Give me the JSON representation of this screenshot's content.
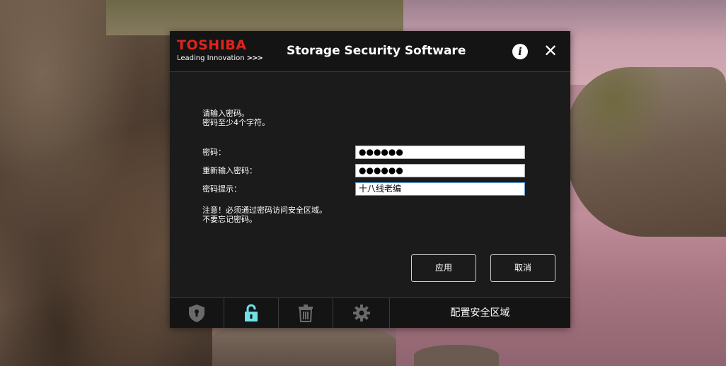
{
  "window": {
    "brand": "TOSHIBA",
    "tagline": "Leading Innovation",
    "tagline_arrows": ">>>",
    "title": "Storage Security Software",
    "info_label": "i",
    "close_label": "✕"
  },
  "form": {
    "instruction_line1": "请输入密码。",
    "instruction_line2": "密码至少4个字符。",
    "password_label": "密码：",
    "password_value": "●●●●●●",
    "confirm_label": "重新输入密码：",
    "confirm_value": "●●●●●●",
    "hint_label": "密码提示：",
    "hint_value": "十八线老编",
    "warning_line1": "注意！必须通过密码访问安全区域。",
    "warning_line2": "不要忘记密码。"
  },
  "buttons": {
    "apply": "应用",
    "cancel": "取消"
  },
  "toolbar": {
    "section_label": "配置安全区域",
    "active_tool": "lock",
    "tools": [
      "shield",
      "lock",
      "trash",
      "gear"
    ]
  },
  "colors": {
    "brand_red": "#e0241b",
    "active_icon": "#6ee0e8",
    "inactive_icon": "#6a6a6a",
    "dialog_bg": "#1b1b1b"
  }
}
